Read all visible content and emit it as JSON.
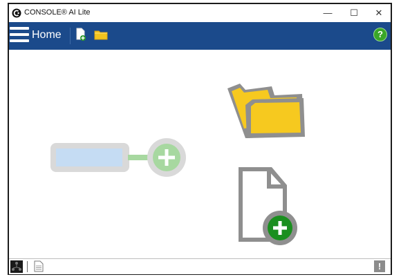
{
  "window": {
    "title": "CONSOLE® AI Lite",
    "minimize_glyph": "—",
    "maximize_glyph": "☐",
    "close_glyph": "✕"
  },
  "toolbar": {
    "home_label": "Home",
    "help_glyph": "?",
    "colors": {
      "background": "#1b4a8b",
      "help": "#3aa628"
    }
  },
  "main": {
    "actions": [
      {
        "name": "connect-device",
        "icon": "connect-plus-icon"
      },
      {
        "name": "open-project",
        "icon": "open-folder-icon"
      },
      {
        "name": "new-project",
        "icon": "new-file-plus-icon"
      }
    ]
  },
  "statusbar": {
    "items": [
      {
        "icon": "network-icon"
      },
      {
        "icon": "log-document-icon"
      },
      {
        "icon": "warning-icon",
        "glyph": "!"
      }
    ]
  }
}
